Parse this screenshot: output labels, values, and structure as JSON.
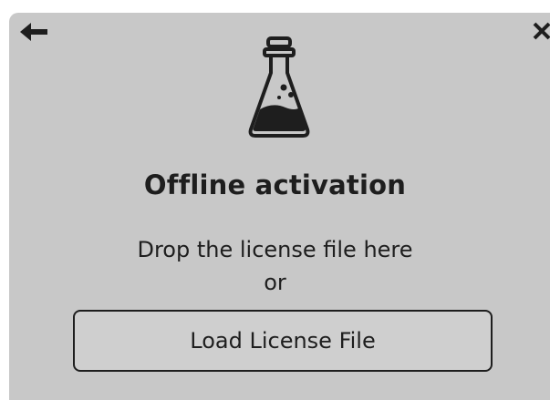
{
  "dialog": {
    "title": "Offline activation",
    "instruction": "Drop the license file here",
    "separator": "or",
    "load_button_label": "Load License File"
  },
  "icons": {
    "back": "back-arrow-icon",
    "close": "close-icon",
    "illustration": "flask-icon"
  },
  "colors": {
    "background": "#c8c8c8",
    "text": "#1e1e1e"
  }
}
